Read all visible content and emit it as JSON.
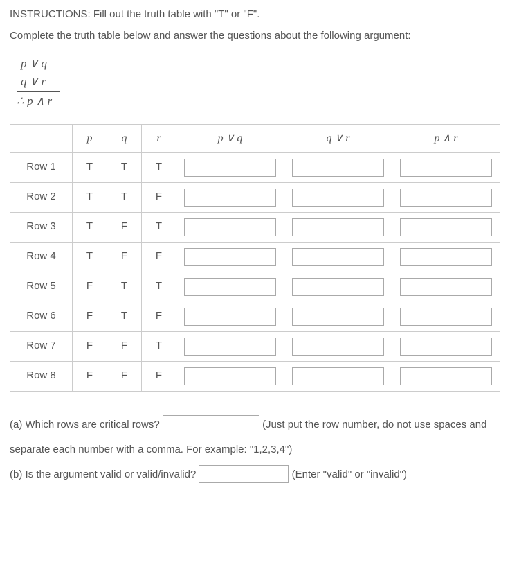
{
  "instructions": "INSTRUCTIONS: Fill out the truth table with \"T\" or \"F\".",
  "explanation": "Complete the truth table below and answer the questions about the following argument:",
  "argument": {
    "premise1": "p ∨ q",
    "premise2": "q ∨ r",
    "conclusion": "∴ p ∧ r"
  },
  "headers": {
    "row": "",
    "p": "p",
    "q": "q",
    "r": "r",
    "pvq": "p ∨ q",
    "qvr": "q ∨ r",
    "par": "p ∧ r"
  },
  "rows": [
    {
      "label": "Row 1",
      "p": "T",
      "q": "T",
      "r": "T"
    },
    {
      "label": "Row 2",
      "p": "T",
      "q": "T",
      "r": "F"
    },
    {
      "label": "Row 3",
      "p": "T",
      "q": "F",
      "r": "T"
    },
    {
      "label": "Row 4",
      "p": "T",
      "q": "F",
      "r": "F"
    },
    {
      "label": "Row 5",
      "p": "F",
      "q": "T",
      "r": "T"
    },
    {
      "label": "Row 6",
      "p": "F",
      "q": "T",
      "r": "F"
    },
    {
      "label": "Row 7",
      "p": "F",
      "q": "F",
      "r": "T"
    },
    {
      "label": "Row 8",
      "p": "F",
      "q": "F",
      "r": "F"
    }
  ],
  "question_a": {
    "prefix": "(a) Which rows are critical rows? ",
    "suffix": " (Just put the row number, do not use spaces and separate each number with a comma. For example: \"1,2,3,4\")"
  },
  "question_b": {
    "prefix": "(b) Is the argument valid or valid/invalid? ",
    "suffix": " (Enter \"valid\" or \"invalid\")"
  }
}
